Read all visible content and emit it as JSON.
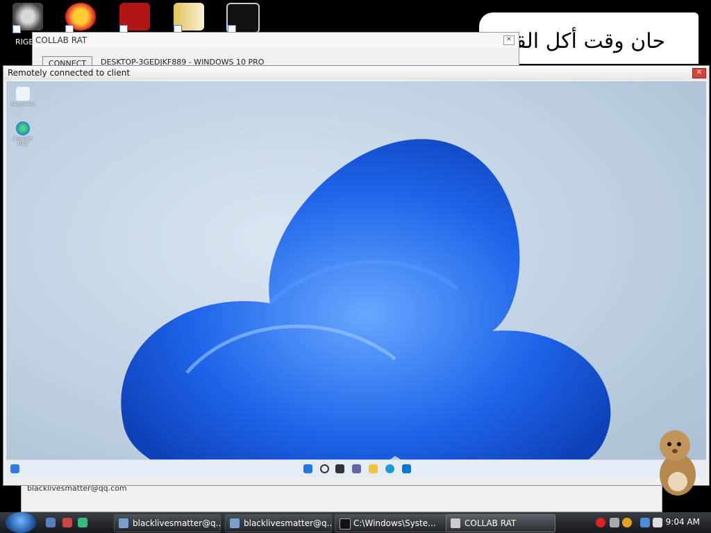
{
  "desktop": {
    "icons": [
      "raccoon-app-icon",
      "p-app-icon",
      "flash-app-icon",
      "hxd-app-icon",
      "cmd-app-icon"
    ],
    "visible_label": "RIGE"
  },
  "note": {
    "text": "حان وقت أكل القر"
  },
  "collab": {
    "title": "COLLAB RAT",
    "connect_label": "CONNECT",
    "client_info": "DESKTOP-3GEDJKF889 - WINDOWS 10 PRO"
  },
  "remote": {
    "title": "Remotely connected to client",
    "icons": [
      {
        "label": "Recycle Bin"
      },
      {
        "label": "Microsoft Edge"
      }
    ]
  },
  "lower": {
    "field": "blacklivesmatter@qq.com"
  },
  "taskbar": {
    "tasks": [
      {
        "label": "blacklivesmatter@q...",
        "active": false
      },
      {
        "label": "blacklivesmatter@q...",
        "active": false
      },
      {
        "label": "C:\\Windows\\Syste...",
        "active": false
      },
      {
        "label": "COLLAB RAT",
        "active": true
      }
    ],
    "clock": "9:04 AM"
  },
  "colors": {
    "wallpaper_bloom": "#1e63e9",
    "remote_bg": "#bcd0e4",
    "taskbar": "#1f2327"
  }
}
